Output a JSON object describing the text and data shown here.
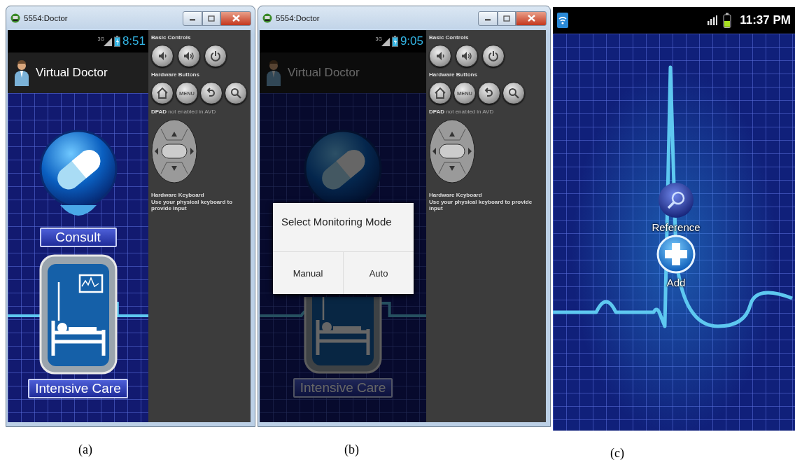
{
  "panels": [
    {
      "kind": "emulator",
      "caption": "(a)",
      "window": {
        "title": "5554:Doctor"
      },
      "status_bar": {
        "network": "3G",
        "time": "8:51"
      },
      "app_bar": {
        "title": "Virtual Doctor"
      },
      "dimmed": false,
      "menu": [
        {
          "kind": "capsule",
          "label": "Consult"
        },
        {
          "kind": "bed",
          "label": "Intensive Care"
        }
      ],
      "controls": {
        "basic_heading": "Basic Controls",
        "hardware_heading": "Hardware Buttons",
        "menu_key": "MENU",
        "dpad_note": "**DPAD** not enabled in AVD",
        "keyboard_heading": "Hardware Keyboard",
        "keyboard_note": "Use your physical keyboard to provide input"
      }
    },
    {
      "kind": "emulator",
      "caption": "(b)",
      "window": {
        "title": "5554:Doctor"
      },
      "status_bar": {
        "network": "3G",
        "time": "9:05"
      },
      "app_bar": {
        "title": "Virtual Doctor"
      },
      "dimmed": true,
      "menu": [
        {
          "kind": "capsule"
        },
        {
          "kind": "bed",
          "label": "Intensive Care"
        }
      ],
      "dialog": {
        "title": "Select Monitoring Mode",
        "buttons": [
          "Manual",
          "Auto"
        ]
      },
      "controls": {
        "basic_heading": "Basic Controls",
        "hardware_heading": "Hardware Buttons",
        "menu_key": "MENU",
        "dpad_note": "**DPAD** not enabled in AVD",
        "keyboard_heading": "Hardware Keyboard",
        "keyboard_note": "Use your physical keyboard to provide input"
      }
    },
    {
      "kind": "phone",
      "caption": "(c)",
      "status_bar": {
        "time": "11:37 PM"
      },
      "actions": [
        {
          "kind": "search",
          "label": "Reference"
        },
        {
          "kind": "add",
          "label": "Add"
        }
      ]
    }
  ]
}
